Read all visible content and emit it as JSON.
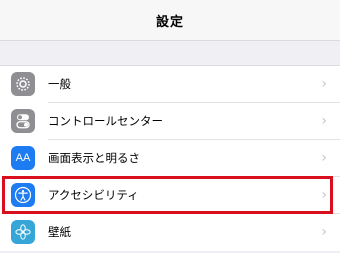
{
  "nav": {
    "title": "設定"
  },
  "rows": [
    {
      "label": "一般",
      "icon": "gear-icon",
      "icon_bg": "#8e8e93"
    },
    {
      "label": "コントロールセンター",
      "icon": "toggle-switches-icon",
      "icon_bg": "#8e8e93"
    },
    {
      "label": "画面表示と明るさ",
      "icon": "text-size-icon",
      "icon_bg": "#1e7cf2",
      "icon_text": "AA"
    },
    {
      "label": "アクセシビリティ",
      "icon": "accessibility-icon",
      "icon_bg": "#1e7cf2"
    },
    {
      "label": "壁紙",
      "icon": "flower-icon",
      "icon_bg": "#36a6d8"
    }
  ],
  "chevron": "›",
  "highlight_color": "#d90f1d"
}
